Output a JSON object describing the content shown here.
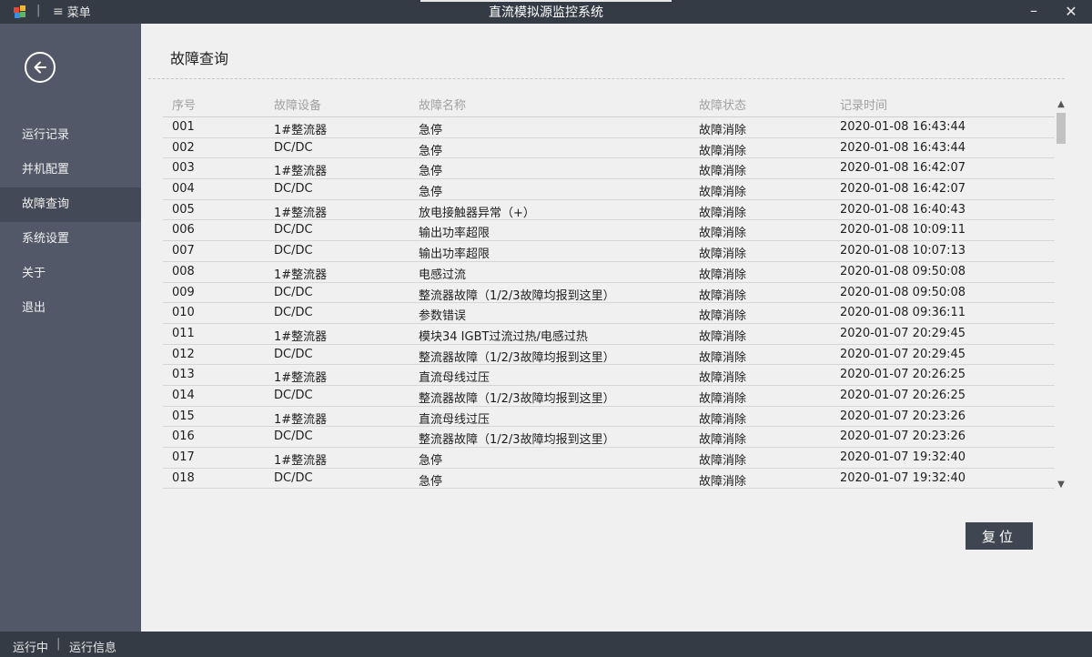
{
  "window": {
    "title": "直流模拟源监控系统",
    "menu_label": "菜单",
    "minimize_glyph": "–",
    "close_glyph": "✕"
  },
  "sidebar": {
    "items": [
      {
        "label": "运行记录",
        "active": false
      },
      {
        "label": "并机配置",
        "active": false
      },
      {
        "label": "故障查询",
        "active": true
      },
      {
        "label": "系统设置",
        "active": false
      },
      {
        "label": "关于",
        "active": false
      },
      {
        "label": "退出",
        "active": false
      }
    ]
  },
  "main": {
    "title": "故障查询",
    "columns": [
      "序号",
      "故障设备",
      "故障名称",
      "故障状态",
      "记录时间"
    ],
    "rows": [
      [
        "001",
        "1#整流器",
        "急停",
        "故障消除",
        "2020-01-08 16:43:44"
      ],
      [
        "002",
        "DC/DC",
        "急停",
        "故障消除",
        "2020-01-08 16:43:44"
      ],
      [
        "003",
        "1#整流器",
        "急停",
        "故障消除",
        "2020-01-08 16:42:07"
      ],
      [
        "004",
        "DC/DC",
        "急停",
        "故障消除",
        "2020-01-08 16:42:07"
      ],
      [
        "005",
        "1#整流器",
        "放电接触器异常（+）",
        "故障消除",
        "2020-01-08 16:40:43"
      ],
      [
        "006",
        "DC/DC",
        "输出功率超限",
        "故障消除",
        "2020-01-08 10:09:11"
      ],
      [
        "007",
        "DC/DC",
        "输出功率超限",
        "故障消除",
        "2020-01-08 10:07:13"
      ],
      [
        "008",
        "1#整流器",
        "电感过流",
        "故障消除",
        "2020-01-08 09:50:08"
      ],
      [
        "009",
        "DC/DC",
        "整流器故障（1/2/3故障均报到这里）",
        "故障消除",
        "2020-01-08 09:50:08"
      ],
      [
        "010",
        "DC/DC",
        "参数错误",
        "故障消除",
        "2020-01-08 09:36:11"
      ],
      [
        "011",
        "1#整流器",
        "模块34 IGBT过流过热/电感过热",
        "故障消除",
        "2020-01-07 20:29:45"
      ],
      [
        "012",
        "DC/DC",
        "整流器故障（1/2/3故障均报到这里）",
        "故障消除",
        "2020-01-07 20:29:45"
      ],
      [
        "013",
        "1#整流器",
        "直流母线过压",
        "故障消除",
        "2020-01-07 20:26:25"
      ],
      [
        "014",
        "DC/DC",
        "整流器故障（1/2/3故障均报到这里）",
        "故障消除",
        "2020-01-07 20:26:25"
      ],
      [
        "015",
        "1#整流器",
        "直流母线过压",
        "故障消除",
        "2020-01-07 20:23:26"
      ],
      [
        "016",
        "DC/DC",
        "整流器故障（1/2/3故障均报到这里）",
        "故障消除",
        "2020-01-07 20:23:26"
      ],
      [
        "017",
        "1#整流器",
        "急停",
        "故障消除",
        "2020-01-07 19:32:40"
      ],
      [
        "018",
        "DC/DC",
        "急停",
        "故障消除",
        "2020-01-07 19:32:40"
      ]
    ],
    "reset_label": "复位"
  },
  "statusbar": {
    "state": "运行中",
    "info_label": "运行信息"
  },
  "colors": {
    "titlebar_bg": "#353b45",
    "sidebar_bg": "#525867",
    "sidebar_active_bg": "#434957",
    "content_bg": "#f0f0f0",
    "button_bg": "#3f4652"
  },
  "icons": {
    "app": "app-logo-icon",
    "menu": "hamburger-icon",
    "back": "arrow-left-circle-icon",
    "scroll_up": "chevron-up-icon",
    "scroll_down": "chevron-down-icon"
  }
}
